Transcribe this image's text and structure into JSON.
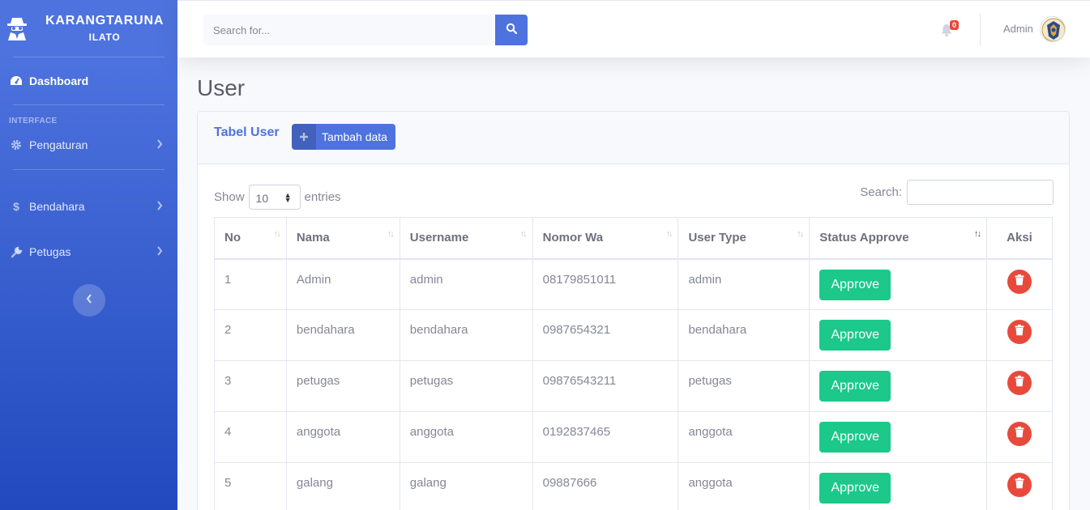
{
  "sidebar": {
    "brand_line1": "KARANGTARUNA",
    "brand_line2": "ILATO",
    "dashboard": "Dashboard",
    "heading_interface": "INTERFACE",
    "items": [
      {
        "label": "Pengaturan",
        "icon": "gear-icon"
      },
      {
        "label": "Bendahara",
        "icon": "dollar-icon"
      },
      {
        "label": "Petugas",
        "icon": "wrench-icon"
      }
    ]
  },
  "topbar": {
    "search_placeholder": "Search for...",
    "notification_count": "0",
    "user_name": "Admin"
  },
  "page": {
    "title": "User",
    "card_title": "Tabel User",
    "add_button": "Tambah data",
    "show_label": "Show",
    "entries_value": "10",
    "entries_label": "entries",
    "search_label": "Search:"
  },
  "table": {
    "columns": [
      "No",
      "Nama",
      "Username",
      "Nomor Wa",
      "User Type",
      "Status Approve",
      "Aksi"
    ],
    "rows": [
      {
        "no": "1",
        "nama": "Admin",
        "username": "admin",
        "wa": "08179851011",
        "type": "admin",
        "status": "Approve"
      },
      {
        "no": "2",
        "nama": "bendahara",
        "username": "bendahara",
        "wa": "0987654321",
        "type": "bendahara",
        "status": "Approve"
      },
      {
        "no": "3",
        "nama": "petugas",
        "username": "petugas",
        "wa": "09876543211",
        "type": "petugas",
        "status": "Approve"
      },
      {
        "no": "4",
        "nama": "anggota",
        "username": "anggota",
        "wa": "0192837465",
        "type": "anggota",
        "status": "Approve"
      },
      {
        "no": "5",
        "nama": "galang",
        "username": "galang",
        "wa": "09887666",
        "type": "anggota",
        "status": "Approve"
      }
    ]
  },
  "colors": {
    "primary": "#4e73df",
    "success": "#1cc88a",
    "danger": "#e74a3b"
  }
}
